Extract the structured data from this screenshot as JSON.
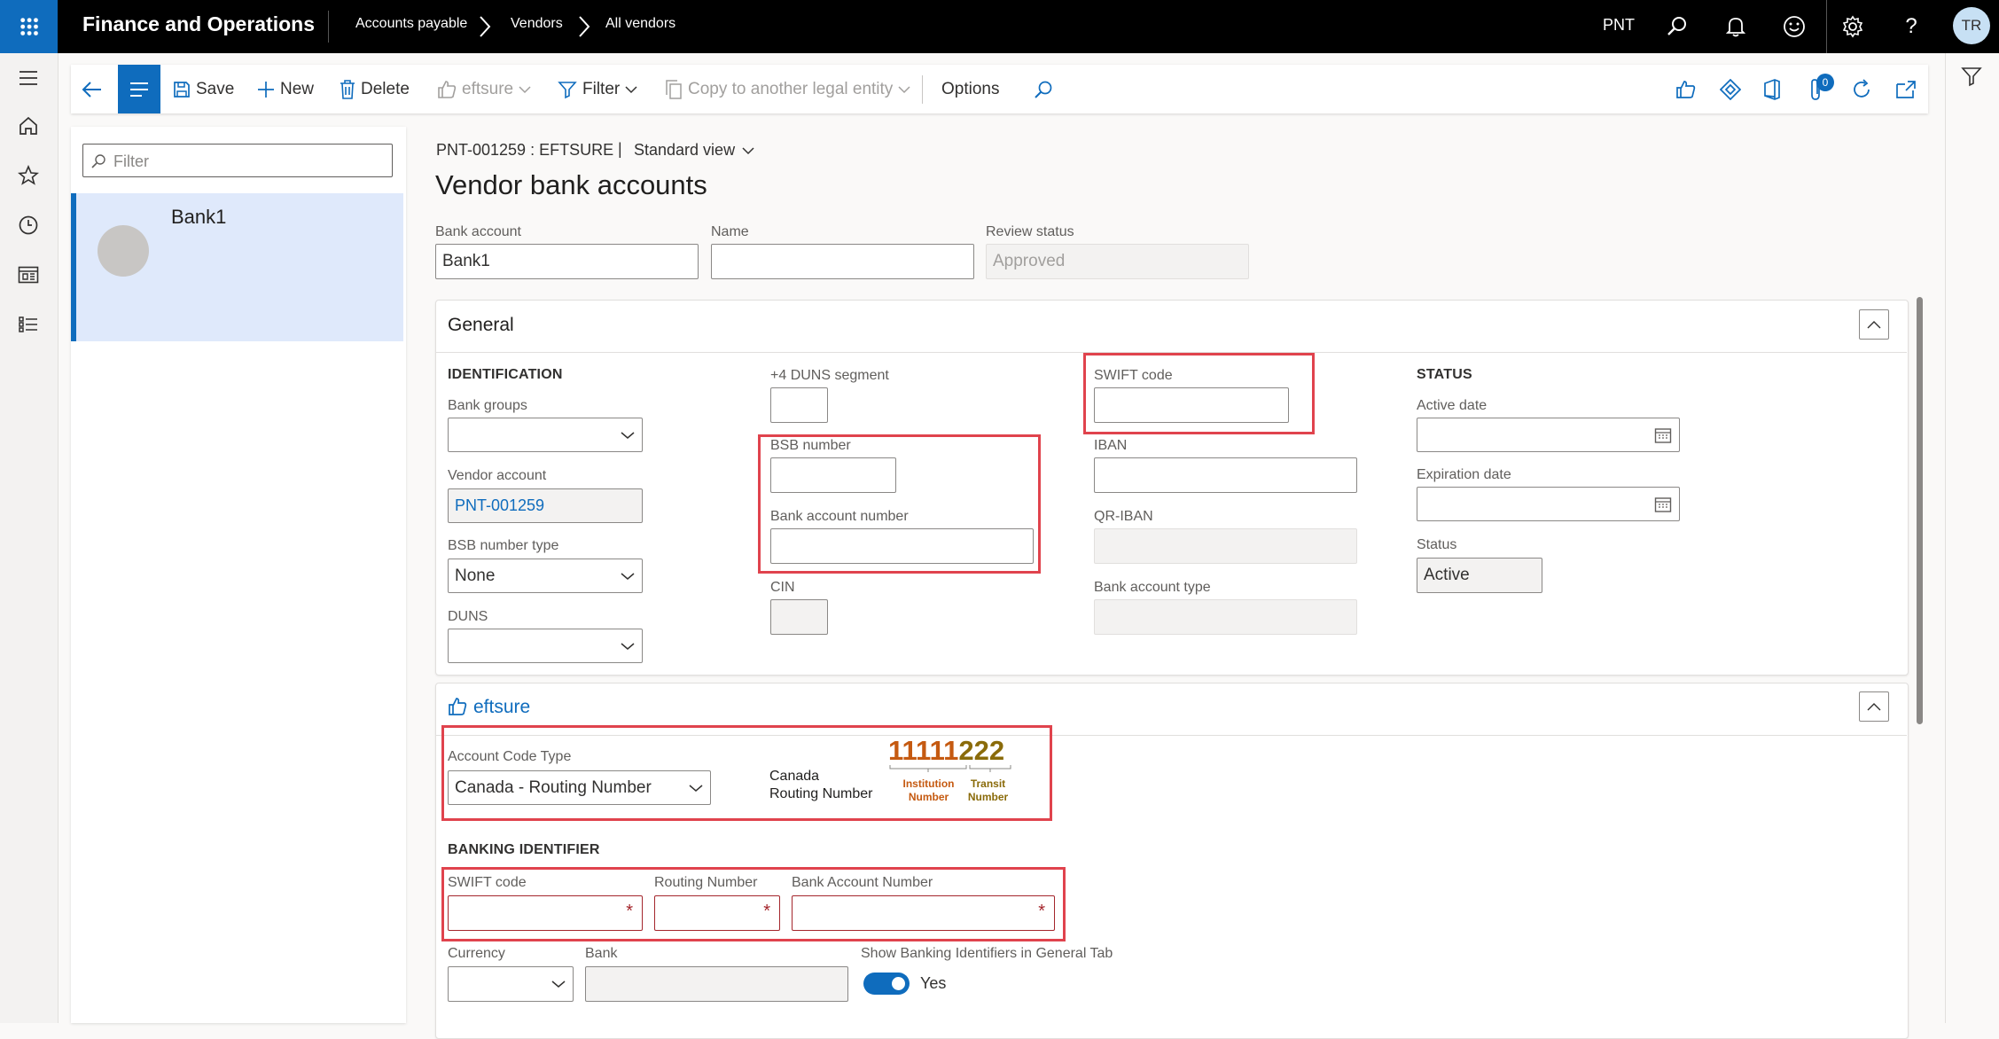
{
  "app": {
    "title": "Finance and Operations"
  },
  "breadcrumb": [
    "Accounts payable",
    "Vendors",
    "All vendors"
  ],
  "topbar": {
    "company": "PNT",
    "user_initials": "TR"
  },
  "actions": {
    "save": "Save",
    "new": "New",
    "delete": "Delete",
    "eftsure": "eftsure",
    "filter": "Filter",
    "copy": "Copy to another legal entity",
    "options": "Options",
    "attachments_count": "0"
  },
  "list": {
    "filter_placeholder": "Filter",
    "items": [
      {
        "name": "Bank1"
      }
    ]
  },
  "form": {
    "context": "PNT-001259 : EFTSURE",
    "separator": "|",
    "view": "Standard view",
    "title": "Vendor bank accounts",
    "bank_account_label": "Bank account",
    "bank_account": "Bank1",
    "name_label": "Name",
    "name": "",
    "review_status_label": "Review status",
    "review_status": "Approved"
  },
  "general": {
    "title": "General",
    "identification": "IDENTIFICATION",
    "bank_groups_label": "Bank groups",
    "vendor_account_label": "Vendor account",
    "vendor_account": "PNT-001259",
    "bsb_type_label": "BSB number type",
    "bsb_type": "None",
    "duns_label": "DUNS",
    "duns4_label": "+4 DUNS segment",
    "bsb_number_label": "BSB number",
    "bank_account_number_label": "Bank account number",
    "cin_label": "CIN",
    "swift_label": "SWIFT code",
    "iban_label": "IBAN",
    "qr_iban_label": "QR-IBAN",
    "bank_account_type_label": "Bank account type",
    "status_header": "STATUS",
    "active_date_label": "Active date",
    "expiration_date_label": "Expiration date",
    "status_label": "Status",
    "status": "Active"
  },
  "eftsure": {
    "title": "eftsure",
    "account_code_type_label": "Account Code Type",
    "account_code_type": "Canada - Routing Number",
    "hint_line1": "Canada",
    "hint_line2": "Routing Number",
    "routing_example_a": "11111",
    "routing_example_b": "222",
    "institution_l1": "Institution",
    "institution_l2": "Number",
    "transit_l1": "Transit",
    "transit_l2": "Number",
    "banking_identifier": "BANKING IDENTIFIER",
    "swift_label": "SWIFT code",
    "routing_label": "Routing Number",
    "bank_account_number_label": "Bank Account Number",
    "required_mark": "*",
    "currency_label": "Currency",
    "bank_label": "Bank",
    "show_label": "Show Banking Identifiers in General Tab",
    "show_value": "Yes"
  },
  "colors": {
    "accent": "#0f6cbd",
    "highlight": "#e0434d",
    "required": "#a4262c"
  }
}
